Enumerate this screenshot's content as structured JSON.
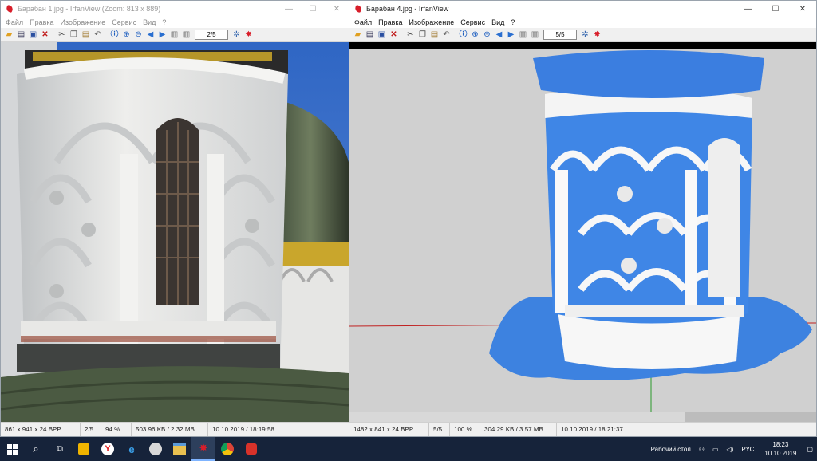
{
  "windows": [
    {
      "title": "Барабан 1.jpg - IrfanView (Zoom: 813 x 889)",
      "menu": [
        "Файл",
        "Правка",
        "Изображение",
        "Сервис",
        "Вид",
        "?"
      ],
      "page_counter": "2/5",
      "status": [
        "861 x 941 x 24 BPP",
        "2/5",
        "94 %",
        "503.96 KB / 2.32 MB",
        "10.10.2019 / 18:19:58"
      ]
    },
    {
      "title": "Барабан 4.jpg - IrfanView",
      "menu": [
        "Файл",
        "Правка",
        "Изображение",
        "Сервис",
        "Вид",
        "?"
      ],
      "page_counter": "5/5",
      "status": [
        "1482 x 841 x 24 BPP",
        "5/5",
        "100 %",
        "304.29 KB / 3.57 MB",
        "10.10.2019 / 18:21:37"
      ]
    }
  ],
  "window_controls": {
    "minimize": "—",
    "maximize": "☐",
    "close": "✕"
  },
  "toolbar_icons": [
    "open-folder-icon",
    "slideshow-icon",
    "save-icon",
    "delete-icon",
    "cut-icon",
    "copy-icon",
    "paste-icon",
    "undo-icon",
    "info-icon",
    "zoom-in-icon",
    "zoom-out-icon",
    "prev-arrow-icon",
    "next-arrow-icon",
    "first-page-icon",
    "last-page-icon",
    "settings-icon",
    "irfanview-icon"
  ],
  "taskbar": {
    "apps": [
      "start",
      "search",
      "task-view",
      "file-manager",
      "yandex-browser",
      "edge",
      "media-player",
      "explorer",
      "irfanview",
      "chrome",
      "app"
    ],
    "desktop_label": "Рабочий стол",
    "language": "РУС",
    "time": "18:23",
    "date": "10.10.2019"
  }
}
